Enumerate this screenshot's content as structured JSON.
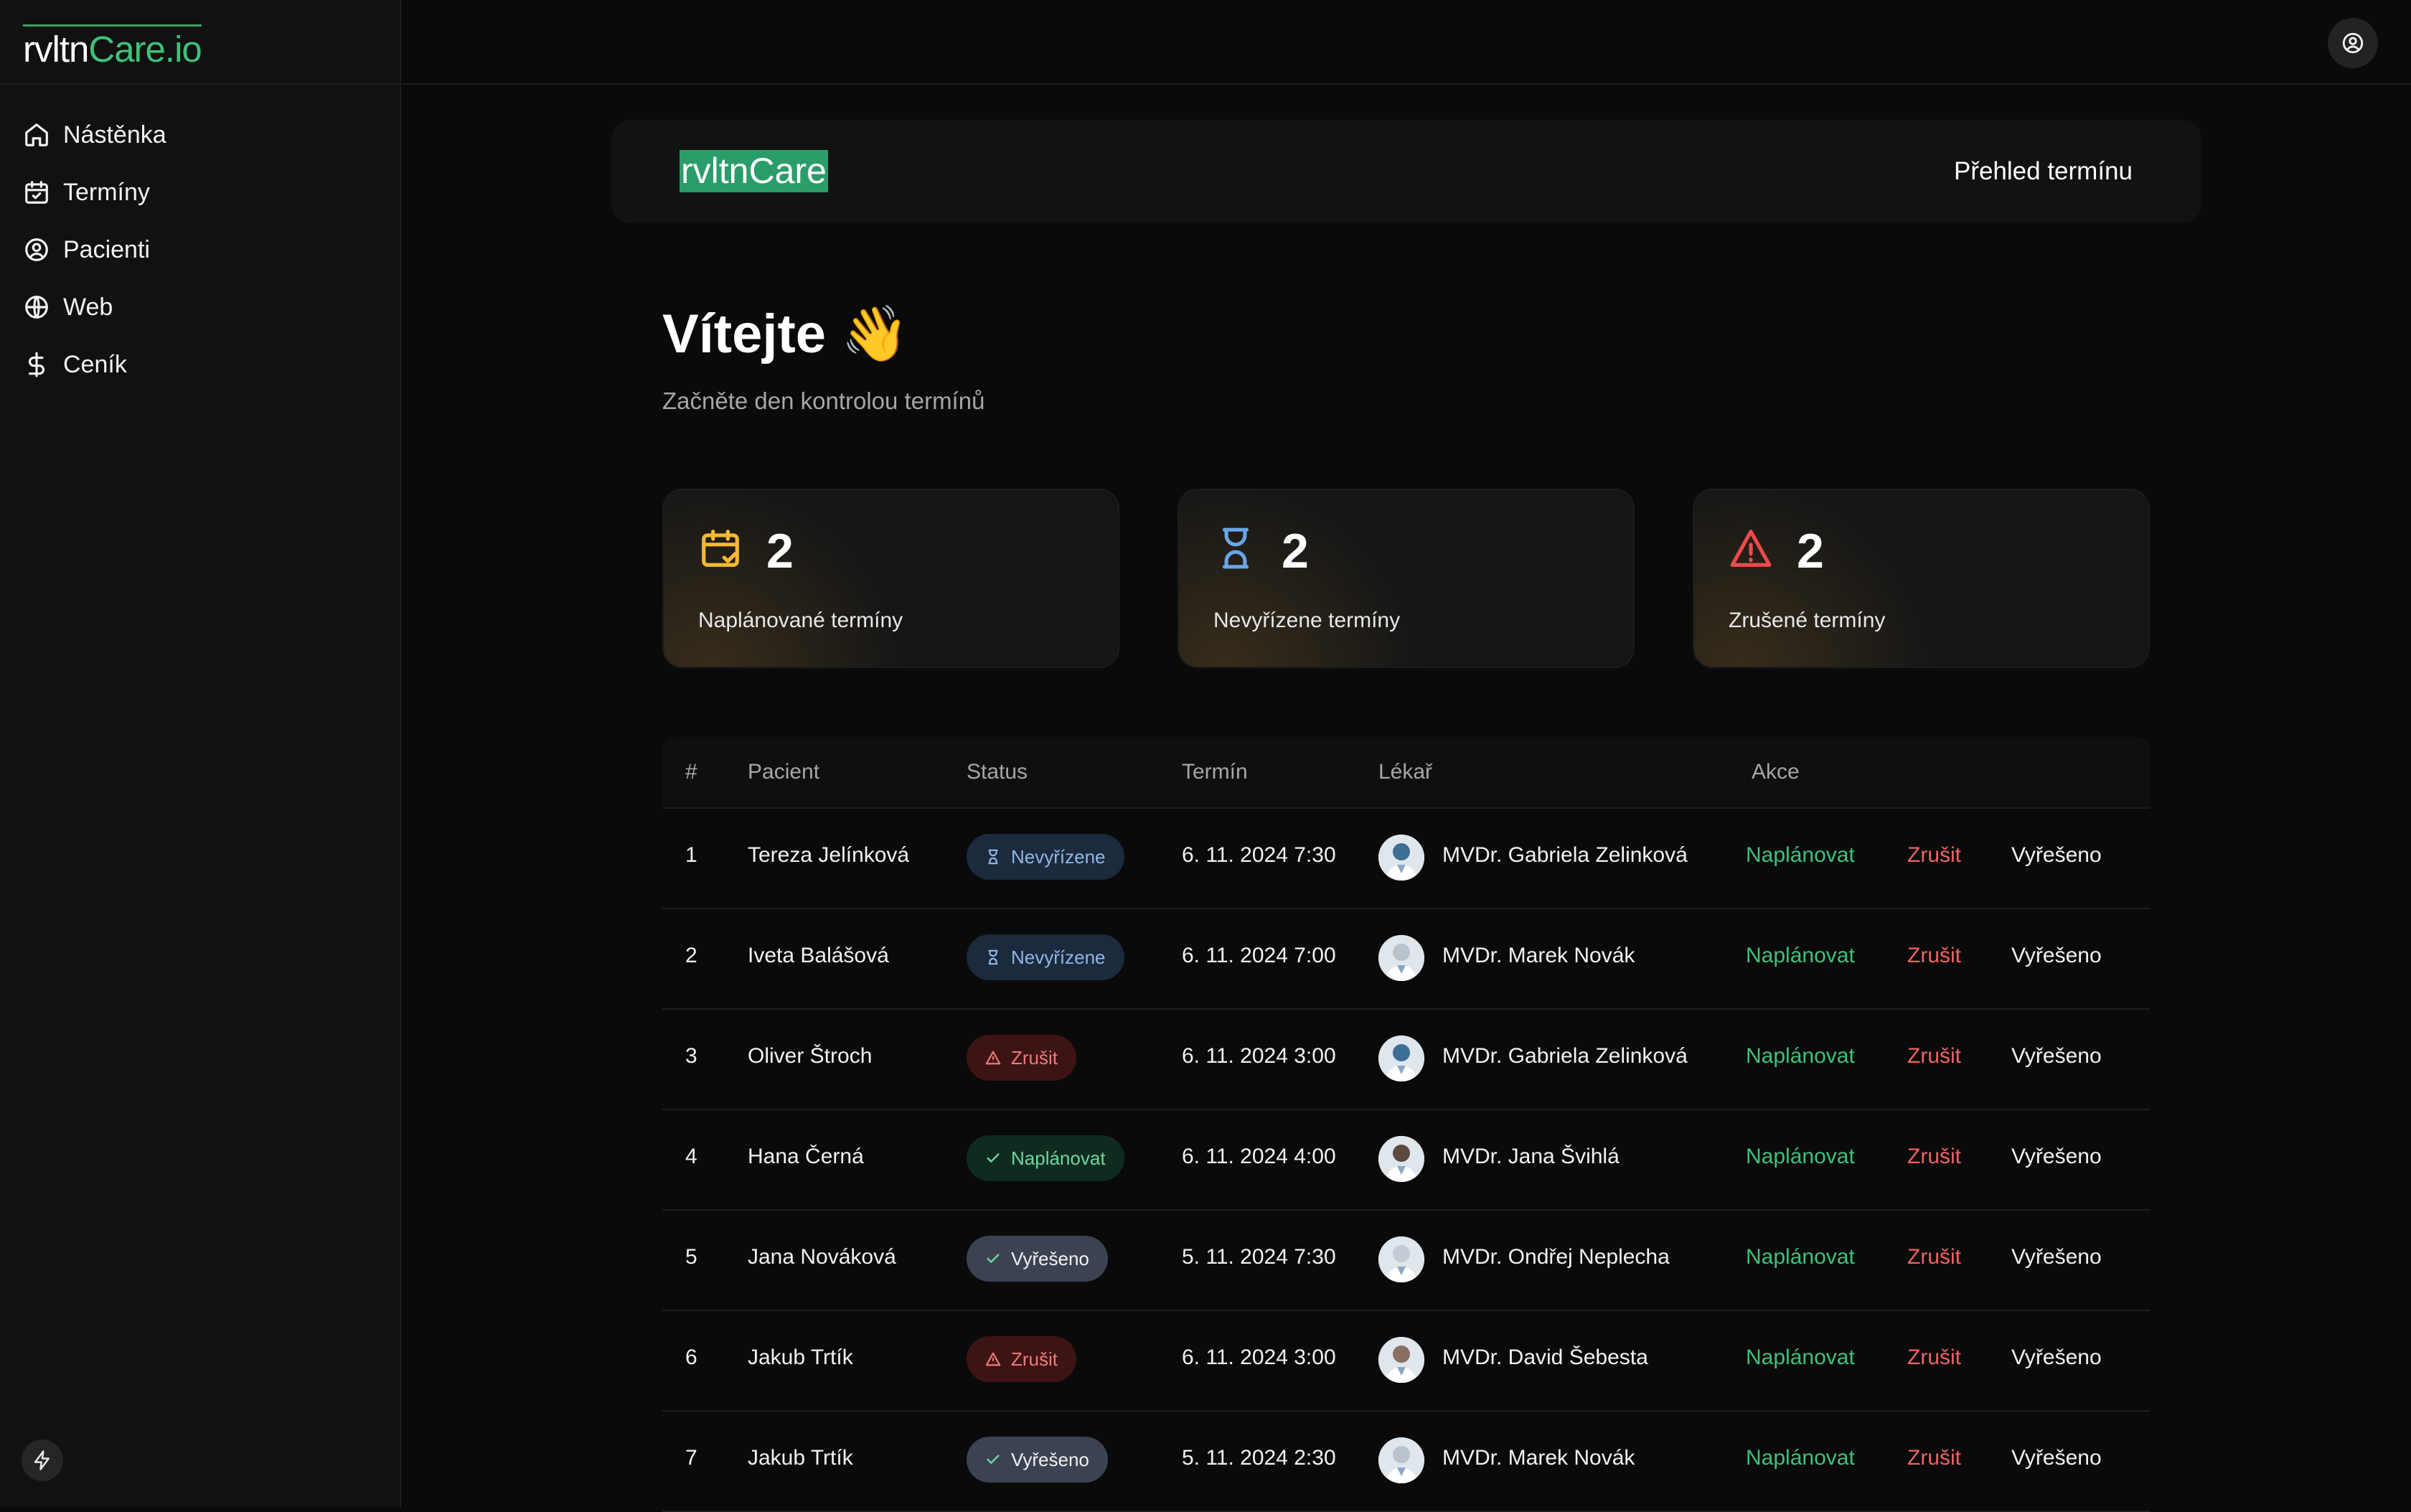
{
  "brand": {
    "prefix": "rvltn",
    "accent": "Care.io"
  },
  "nav": [
    {
      "label": "Nástěnka",
      "icon": "home-icon"
    },
    {
      "label": "Termíny",
      "icon": "calendar-check-icon"
    },
    {
      "label": "Pacienti",
      "icon": "user-circle-icon"
    },
    {
      "label": "Web",
      "icon": "globe-icon"
    },
    {
      "label": "Ceník",
      "icon": "dollar-icon"
    }
  ],
  "hero": {
    "logo": "rvltnCare",
    "link": "Přehled termínu"
  },
  "welcome": {
    "title": "Vítejte 👋",
    "subtitle": "Začněte den kontrolou termínů"
  },
  "stats": [
    {
      "value": "2",
      "label": "Naplánované termíny",
      "icon": "calendar-check-icon",
      "color": "#f5b935"
    },
    {
      "value": "2",
      "label": "Nevyřízene termíny",
      "icon": "hourglass-icon",
      "color": "#6aa6e8"
    },
    {
      "value": "2",
      "label": "Zrušené termíny",
      "icon": "warning-icon",
      "color": "#ee4a4a"
    }
  ],
  "table": {
    "headers": [
      "#",
      "Pacient",
      "Status",
      "Termín",
      "Lékař",
      "Akce"
    ],
    "actions": {
      "plan": "Naplánovat",
      "cancel": "Zrušit",
      "done": "Vyřešeno"
    },
    "rows": [
      {
        "n": "1",
        "patient": "Tereza Jelínková",
        "status": "Nevyřízene",
        "status_type": "pending",
        "date": "6. 11. 2024 7:30",
        "doctor": "MVDr. Gabriela Zelinková"
      },
      {
        "n": "2",
        "patient": "Iveta Balášová",
        "status": "Nevyřízene",
        "status_type": "pending",
        "date": "6. 11. 2024 7:00",
        "doctor": "MVDr. Marek Novák"
      },
      {
        "n": "3",
        "patient": "Oliver Štroch",
        "status": "Zrušit",
        "status_type": "cancel",
        "date": "6. 11. 2024 3:00",
        "doctor": "MVDr. Gabriela Zelinková"
      },
      {
        "n": "4",
        "patient": "Hana Černá",
        "status": "Naplánovat",
        "status_type": "planned",
        "date": "6. 11. 2024 4:00",
        "doctor": "MVDr. Jana Švihlá"
      },
      {
        "n": "5",
        "patient": "Jana Nováková",
        "status": "Vyřešeno",
        "status_type": "resolved",
        "date": "5. 11. 2024 7:30",
        "doctor": "MVDr. Ondřej Neplecha"
      },
      {
        "n": "6",
        "patient": "Jakub Trtík",
        "status": "Zrušit",
        "status_type": "cancel",
        "date": "6. 11. 2024 3:00",
        "doctor": "MVDr. David Šebesta"
      },
      {
        "n": "7",
        "patient": "Jakub Trtík",
        "status": "Vyřešeno",
        "status_type": "resolved",
        "date": "5. 11. 2024 2:30",
        "doctor": "MVDr. Marek Novák"
      }
    ]
  }
}
